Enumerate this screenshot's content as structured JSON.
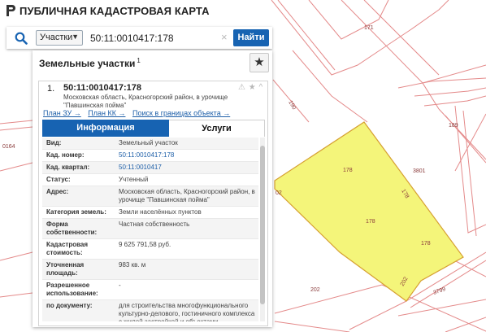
{
  "app": {
    "title": "ПУБЛИЧНАЯ КАДАСТРОВАЯ КАРТА"
  },
  "search": {
    "type_label": "Участки",
    "query": "50:11:0010417:178",
    "clear": "×",
    "find_label": "Найти"
  },
  "panel": {
    "title": "Земельные участки",
    "count": "1",
    "star": "★"
  },
  "result": {
    "index": "1.",
    "cadastral_id": "50:11:0010417:178",
    "address": "Московская область, Красногорский район, в урочище \"Павшинская пойма\"",
    "icons": "⚠ ★ ^",
    "links": [
      "План ЗУ →",
      "План КК →",
      "Поиск в границах объекта →"
    ]
  },
  "tabs": {
    "info": "Информация",
    "services": "Услуги"
  },
  "info_rows": [
    {
      "key": "Вид:",
      "value": "Земельный участок"
    },
    {
      "key": "Кад. номер:",
      "value": "50:11:0010417:178"
    },
    {
      "key": "Кад. квартал:",
      "value": "50:11:0010417"
    },
    {
      "key": "Статус:",
      "value": "Учтенный"
    },
    {
      "key": "Адрес:",
      "value": "Московская область, Красногорский район, в урочище \"Павшинская пойма\""
    },
    {
      "key": "Категория земель:",
      "value": "Земли населённых пунктов"
    },
    {
      "key": "Форма собственности:",
      "value": "Частная собственность"
    },
    {
      "key": "Кадастровая стоимость:",
      "value": "9 625 791,58 руб."
    },
    {
      "key": "Уточненная площадь:",
      "value": "983 кв. м"
    },
    {
      "key": "Разрешенное использование:",
      "value": "-"
    },
    {
      "key": "по документу:",
      "value": "для строительства многофункционального культурно-делового, гостиничного комплекса с жилой застройкой и объектами спортивного назначения"
    }
  ],
  "map_labels": {
    "l171": "171",
    "l190": "190",
    "l189": "189",
    "l164": "0164",
    "l02": "02",
    "l178a": "178",
    "l178b": "178",
    "l178c": "178",
    "l178d": "178",
    "l3801": "3801",
    "l202a": "202",
    "l202b": "202",
    "l3799": "3799"
  },
  "colors": {
    "brand_blue": "#1763b2",
    "parcel_fill": "#f4f57a",
    "parcel_stroke": "#d6a032",
    "boundary": "#e48a8a",
    "link": "#1e5fa8"
  }
}
